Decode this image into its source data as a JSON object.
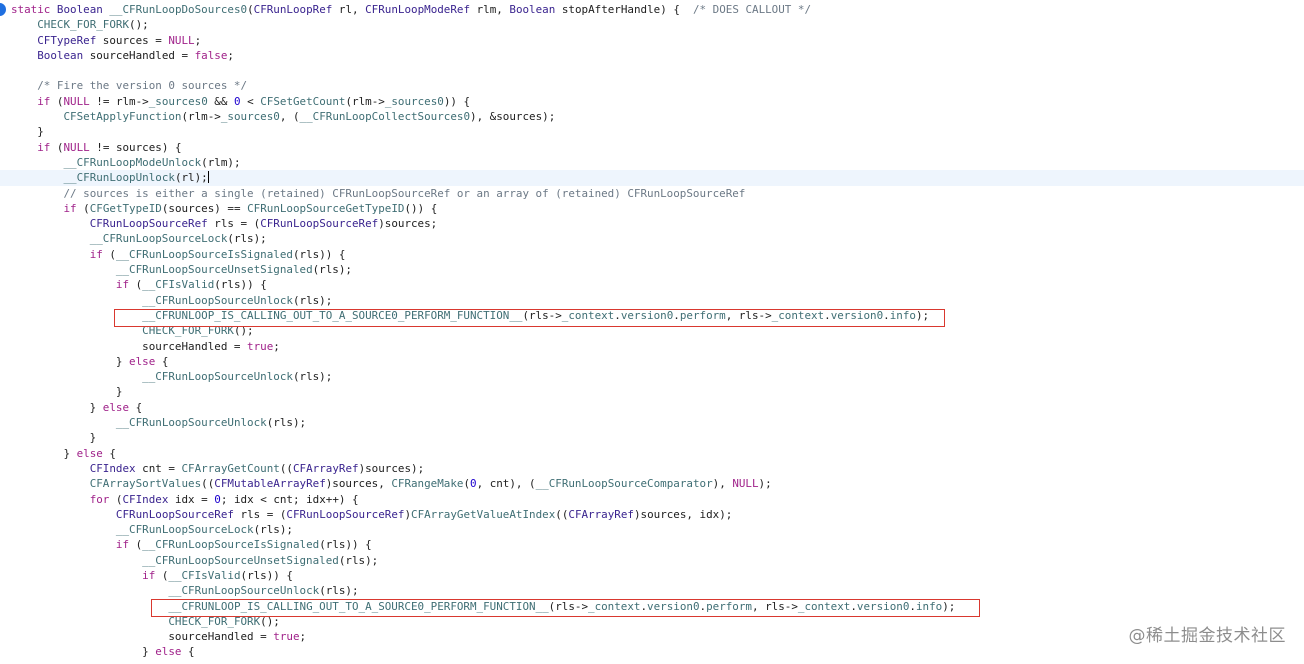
{
  "editor": {
    "lines": [
      {
        "current": false,
        "tokens": [
          {
            "t": "static ",
            "c": "kw"
          },
          {
            "t": "Boolean ",
            "c": "kt"
          },
          {
            "t": "__CFRunLoopDoSources0",
            "c": "fn"
          },
          {
            "t": "(",
            "c": "pl"
          },
          {
            "t": "CFRunLoopRef",
            "c": "kt"
          },
          {
            "t": " rl, ",
            "c": "pl"
          },
          {
            "t": "CFRunLoopModeRef",
            "c": "kt"
          },
          {
            "t": " rlm, ",
            "c": "pl"
          },
          {
            "t": "Boolean",
            "c": "kt"
          },
          {
            "t": " stopAfterHandle) {  ",
            "c": "pl"
          },
          {
            "t": "/* DOES CALLOUT */",
            "c": "cm"
          }
        ]
      },
      {
        "current": false,
        "tokens": [
          {
            "t": "    ",
            "c": "pl"
          },
          {
            "t": "CHECK_FOR_FORK",
            "c": "fn"
          },
          {
            "t": "();",
            "c": "pl"
          }
        ]
      },
      {
        "current": false,
        "tokens": [
          {
            "t": "    ",
            "c": "pl"
          },
          {
            "t": "CFTypeRef",
            "c": "kt"
          },
          {
            "t": " sources = ",
            "c": "pl"
          },
          {
            "t": "NULL",
            "c": "kw"
          },
          {
            "t": ";",
            "c": "pl"
          }
        ]
      },
      {
        "current": false,
        "tokens": [
          {
            "t": "    ",
            "c": "pl"
          },
          {
            "t": "Boolean",
            "c": "kt"
          },
          {
            "t": " sourceHandled = ",
            "c": "pl"
          },
          {
            "t": "false",
            "c": "kw"
          },
          {
            "t": ";",
            "c": "pl"
          }
        ]
      },
      {
        "current": false,
        "tokens": []
      },
      {
        "current": false,
        "tokens": [
          {
            "t": "    ",
            "c": "pl"
          },
          {
            "t": "/* Fire the version 0 sources */",
            "c": "cm"
          }
        ]
      },
      {
        "current": false,
        "tokens": [
          {
            "t": "    ",
            "c": "pl"
          },
          {
            "t": "if",
            "c": "kw"
          },
          {
            "t": " (",
            "c": "pl"
          },
          {
            "t": "NULL",
            "c": "kw"
          },
          {
            "t": " != rlm->",
            "c": "pl"
          },
          {
            "t": "_sources0",
            "c": "fn"
          },
          {
            "t": " && ",
            "c": "pl"
          },
          {
            "t": "0",
            "c": "nm"
          },
          {
            "t": " < ",
            "c": "pl"
          },
          {
            "t": "CFSetGetCount",
            "c": "fn"
          },
          {
            "t": "(rlm->",
            "c": "pl"
          },
          {
            "t": "_sources0",
            "c": "fn"
          },
          {
            "t": ")) {",
            "c": "pl"
          }
        ]
      },
      {
        "current": false,
        "tokens": [
          {
            "t": "        ",
            "c": "pl"
          },
          {
            "t": "CFSetApplyFunction",
            "c": "fn"
          },
          {
            "t": "(rlm->",
            "c": "pl"
          },
          {
            "t": "_sources0",
            "c": "fn"
          },
          {
            "t": ", (",
            "c": "pl"
          },
          {
            "t": "__CFRunLoopCollectSources0",
            "c": "fn"
          },
          {
            "t": "), &sources);",
            "c": "pl"
          }
        ]
      },
      {
        "current": false,
        "tokens": [
          {
            "t": "    }",
            "c": "pl"
          }
        ]
      },
      {
        "current": false,
        "tokens": [
          {
            "t": "    ",
            "c": "pl"
          },
          {
            "t": "if",
            "c": "kw"
          },
          {
            "t": " (",
            "c": "pl"
          },
          {
            "t": "NULL",
            "c": "kw"
          },
          {
            "t": " != sources) {",
            "c": "pl"
          }
        ]
      },
      {
        "current": false,
        "tokens": [
          {
            "t": "        ",
            "c": "pl"
          },
          {
            "t": "__CFRunLoopModeUnlock",
            "c": "fn"
          },
          {
            "t": "(rlm);",
            "c": "pl"
          }
        ]
      },
      {
        "current": true,
        "tokens": [
          {
            "t": "        ",
            "c": "pl"
          },
          {
            "t": "__CFRunLoopUnlock",
            "c": "fn"
          },
          {
            "t": "(rl);",
            "c": "pl"
          }
        ]
      },
      {
        "current": false,
        "tokens": [
          {
            "t": "        ",
            "c": "pl"
          },
          {
            "t": "// sources is either a single (retained) CFRunLoopSourceRef or an array of (retained) CFRunLoopSourceRef",
            "c": "cm"
          }
        ]
      },
      {
        "current": false,
        "tokens": [
          {
            "t": "        ",
            "c": "pl"
          },
          {
            "t": "if",
            "c": "kw"
          },
          {
            "t": " (",
            "c": "pl"
          },
          {
            "t": "CFGetTypeID",
            "c": "fn"
          },
          {
            "t": "(sources) == ",
            "c": "pl"
          },
          {
            "t": "CFRunLoopSourceGetTypeID",
            "c": "fn"
          },
          {
            "t": "()) {",
            "c": "pl"
          }
        ]
      },
      {
        "current": false,
        "tokens": [
          {
            "t": "            ",
            "c": "pl"
          },
          {
            "t": "CFRunLoopSourceRef",
            "c": "kt"
          },
          {
            "t": " rls = (",
            "c": "pl"
          },
          {
            "t": "CFRunLoopSourceRef",
            "c": "kt"
          },
          {
            "t": ")sources;",
            "c": "pl"
          }
        ]
      },
      {
        "current": false,
        "tokens": [
          {
            "t": "            ",
            "c": "pl"
          },
          {
            "t": "__CFRunLoopSourceLock",
            "c": "fn"
          },
          {
            "t": "(rls);",
            "c": "pl"
          }
        ]
      },
      {
        "current": false,
        "tokens": [
          {
            "t": "            ",
            "c": "pl"
          },
          {
            "t": "if",
            "c": "kw"
          },
          {
            "t": " (",
            "c": "pl"
          },
          {
            "t": "__CFRunLoopSourceIsSignaled",
            "c": "fn"
          },
          {
            "t": "(rls)) {",
            "c": "pl"
          }
        ]
      },
      {
        "current": false,
        "tokens": [
          {
            "t": "                ",
            "c": "pl"
          },
          {
            "t": "__CFRunLoopSourceUnsetSignaled",
            "c": "fn"
          },
          {
            "t": "(rls);",
            "c": "pl"
          }
        ]
      },
      {
        "current": false,
        "tokens": [
          {
            "t": "                ",
            "c": "pl"
          },
          {
            "t": "if",
            "c": "kw"
          },
          {
            "t": " (",
            "c": "pl"
          },
          {
            "t": "__CFIsValid",
            "c": "fn"
          },
          {
            "t": "(rls)) {",
            "c": "pl"
          }
        ]
      },
      {
        "current": false,
        "tokens": [
          {
            "t": "                    ",
            "c": "pl"
          },
          {
            "t": "__CFRunLoopSourceUnlock",
            "c": "fn"
          },
          {
            "t": "(rls);",
            "c": "pl"
          }
        ]
      },
      {
        "current": false,
        "tokens": [
          {
            "t": "                    ",
            "c": "pl"
          },
          {
            "t": "__CFRUNLOOP_IS_CALLING_OUT_TO_A_SOURCE0_PERFORM_FUNCTION__",
            "c": "fn"
          },
          {
            "t": "(rls->",
            "c": "pl"
          },
          {
            "t": "_context",
            "c": "fn"
          },
          {
            "t": ".",
            "c": "pl"
          },
          {
            "t": "version0",
            "c": "fn"
          },
          {
            "t": ".",
            "c": "pl"
          },
          {
            "t": "perform",
            "c": "fn"
          },
          {
            "t": ", rls->",
            "c": "pl"
          },
          {
            "t": "_context",
            "c": "fn"
          },
          {
            "t": ".",
            "c": "pl"
          },
          {
            "t": "version0",
            "c": "fn"
          },
          {
            "t": ".",
            "c": "pl"
          },
          {
            "t": "info",
            "c": "fn"
          },
          {
            "t": ");",
            "c": "pl"
          }
        ]
      },
      {
        "current": false,
        "tokens": [
          {
            "t": "                    ",
            "c": "pl"
          },
          {
            "t": "CHECK_FOR_FORK",
            "c": "fn"
          },
          {
            "t": "();",
            "c": "pl"
          }
        ]
      },
      {
        "current": false,
        "tokens": [
          {
            "t": "                    sourceHandled = ",
            "c": "pl"
          },
          {
            "t": "true",
            "c": "kw"
          },
          {
            "t": ";",
            "c": "pl"
          }
        ]
      },
      {
        "current": false,
        "tokens": [
          {
            "t": "                } ",
            "c": "pl"
          },
          {
            "t": "else",
            "c": "kw"
          },
          {
            "t": " {",
            "c": "pl"
          }
        ]
      },
      {
        "current": false,
        "tokens": [
          {
            "t": "                    ",
            "c": "pl"
          },
          {
            "t": "__CFRunLoopSourceUnlock",
            "c": "fn"
          },
          {
            "t": "(rls);",
            "c": "pl"
          }
        ]
      },
      {
        "current": false,
        "tokens": [
          {
            "t": "                }",
            "c": "pl"
          }
        ]
      },
      {
        "current": false,
        "tokens": [
          {
            "t": "            } ",
            "c": "pl"
          },
          {
            "t": "else",
            "c": "kw"
          },
          {
            "t": " {",
            "c": "pl"
          }
        ]
      },
      {
        "current": false,
        "tokens": [
          {
            "t": "                ",
            "c": "pl"
          },
          {
            "t": "__CFRunLoopSourceUnlock",
            "c": "fn"
          },
          {
            "t": "(rls);",
            "c": "pl"
          }
        ]
      },
      {
        "current": false,
        "tokens": [
          {
            "t": "            }",
            "c": "pl"
          }
        ]
      },
      {
        "current": false,
        "tokens": [
          {
            "t": "        } ",
            "c": "pl"
          },
          {
            "t": "else",
            "c": "kw"
          },
          {
            "t": " {",
            "c": "pl"
          }
        ]
      },
      {
        "current": false,
        "tokens": [
          {
            "t": "            ",
            "c": "pl"
          },
          {
            "t": "CFIndex",
            "c": "kt"
          },
          {
            "t": " cnt = ",
            "c": "pl"
          },
          {
            "t": "CFArrayGetCount",
            "c": "fn"
          },
          {
            "t": "((",
            "c": "pl"
          },
          {
            "t": "CFArrayRef",
            "c": "kt"
          },
          {
            "t": ")sources);",
            "c": "pl"
          }
        ]
      },
      {
        "current": false,
        "tokens": [
          {
            "t": "            ",
            "c": "pl"
          },
          {
            "t": "CFArraySortValues",
            "c": "fn"
          },
          {
            "t": "((",
            "c": "pl"
          },
          {
            "t": "CFMutableArrayRef",
            "c": "kt"
          },
          {
            "t": ")sources, ",
            "c": "pl"
          },
          {
            "t": "CFRangeMake",
            "c": "fn"
          },
          {
            "t": "(",
            "c": "pl"
          },
          {
            "t": "0",
            "c": "nm"
          },
          {
            "t": ", cnt), (",
            "c": "pl"
          },
          {
            "t": "__CFRunLoopSourceComparator",
            "c": "fn"
          },
          {
            "t": "), ",
            "c": "pl"
          },
          {
            "t": "NULL",
            "c": "kw"
          },
          {
            "t": ");",
            "c": "pl"
          }
        ]
      },
      {
        "current": false,
        "tokens": [
          {
            "t": "            ",
            "c": "pl"
          },
          {
            "t": "for",
            "c": "kw"
          },
          {
            "t": " (",
            "c": "pl"
          },
          {
            "t": "CFIndex",
            "c": "kt"
          },
          {
            "t": " idx = ",
            "c": "pl"
          },
          {
            "t": "0",
            "c": "nm"
          },
          {
            "t": "; idx < cnt; idx++) {",
            "c": "pl"
          }
        ]
      },
      {
        "current": false,
        "tokens": [
          {
            "t": "                ",
            "c": "pl"
          },
          {
            "t": "CFRunLoopSourceRef",
            "c": "kt"
          },
          {
            "t": " rls = (",
            "c": "pl"
          },
          {
            "t": "CFRunLoopSourceRef",
            "c": "kt"
          },
          {
            "t": ")",
            "c": "pl"
          },
          {
            "t": "CFArrayGetValueAtIndex",
            "c": "fn"
          },
          {
            "t": "((",
            "c": "pl"
          },
          {
            "t": "CFArrayRef",
            "c": "kt"
          },
          {
            "t": ")sources, idx);",
            "c": "pl"
          }
        ]
      },
      {
        "current": false,
        "tokens": [
          {
            "t": "                ",
            "c": "pl"
          },
          {
            "t": "__CFRunLoopSourceLock",
            "c": "fn"
          },
          {
            "t": "(rls);",
            "c": "pl"
          }
        ]
      },
      {
        "current": false,
        "tokens": [
          {
            "t": "                ",
            "c": "pl"
          },
          {
            "t": "if",
            "c": "kw"
          },
          {
            "t": " (",
            "c": "pl"
          },
          {
            "t": "__CFRunLoopSourceIsSignaled",
            "c": "fn"
          },
          {
            "t": "(rls)) {",
            "c": "pl"
          }
        ]
      },
      {
        "current": false,
        "tokens": [
          {
            "t": "                    ",
            "c": "pl"
          },
          {
            "t": "__CFRunLoopSourceUnsetSignaled",
            "c": "fn"
          },
          {
            "t": "(rls);",
            "c": "pl"
          }
        ]
      },
      {
        "current": false,
        "tokens": [
          {
            "t": "                    ",
            "c": "pl"
          },
          {
            "t": "if",
            "c": "kw"
          },
          {
            "t": " (",
            "c": "pl"
          },
          {
            "t": "__CFIsValid",
            "c": "fn"
          },
          {
            "t": "(rls)) {",
            "c": "pl"
          }
        ]
      },
      {
        "current": false,
        "tokens": [
          {
            "t": "                        ",
            "c": "pl"
          },
          {
            "t": "__CFRunLoopSourceUnlock",
            "c": "fn"
          },
          {
            "t": "(rls);",
            "c": "pl"
          }
        ]
      },
      {
        "current": false,
        "tokens": [
          {
            "t": "                        ",
            "c": "pl"
          },
          {
            "t": "__CFRUNLOOP_IS_CALLING_OUT_TO_A_SOURCE0_PERFORM_FUNCTION__",
            "c": "fn"
          },
          {
            "t": "(rls->",
            "c": "pl"
          },
          {
            "t": "_context",
            "c": "fn"
          },
          {
            "t": ".",
            "c": "pl"
          },
          {
            "t": "version0",
            "c": "fn"
          },
          {
            "t": ".",
            "c": "pl"
          },
          {
            "t": "perform",
            "c": "fn"
          },
          {
            "t": ", rls->",
            "c": "pl"
          },
          {
            "t": "_context",
            "c": "fn"
          },
          {
            "t": ".",
            "c": "pl"
          },
          {
            "t": "version0",
            "c": "fn"
          },
          {
            "t": ".",
            "c": "pl"
          },
          {
            "t": "info",
            "c": "fn"
          },
          {
            "t": ");",
            "c": "pl"
          }
        ]
      },
      {
        "current": false,
        "tokens": [
          {
            "t": "                        ",
            "c": "pl"
          },
          {
            "t": "CHECK_FOR_FORK",
            "c": "fn"
          },
          {
            "t": "();",
            "c": "pl"
          }
        ]
      },
      {
        "current": false,
        "tokens": [
          {
            "t": "                        sourceHandled = ",
            "c": "pl"
          },
          {
            "t": "true",
            "c": "kw"
          },
          {
            "t": ";",
            "c": "pl"
          }
        ]
      },
      {
        "current": false,
        "tokens": [
          {
            "t": "                    } ",
            "c": "pl"
          },
          {
            "t": "else",
            "c": "kw"
          },
          {
            "t": " {",
            "c": "pl"
          }
        ]
      }
    ],
    "highlight_color": "#d9382f",
    "breakpoint_color": "#1f6fe0"
  },
  "watermark": {
    "text": "@稀土掘金技术社区"
  }
}
